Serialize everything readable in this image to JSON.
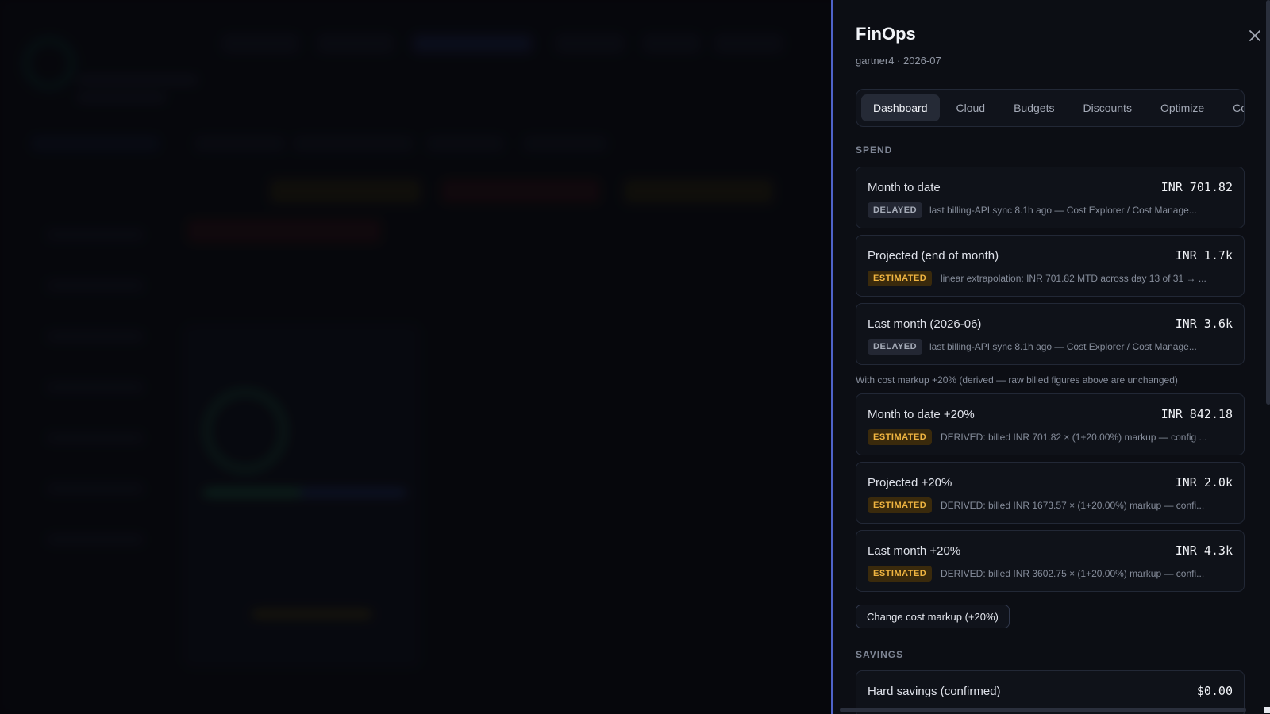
{
  "panel": {
    "title": "FinOps",
    "subtitle": "gartner4 · 2026-07",
    "close_icon": "close-icon",
    "tabs": [
      "Dashboard",
      "Cloud",
      "Budgets",
      "Discounts",
      "Optimize",
      "Con"
    ],
    "active_tab": "Dashboard"
  },
  "spend": {
    "section_label": "SPEND",
    "cards": [
      {
        "label": "Month to date",
        "value": "INR 701.82",
        "badge": "DELAYED",
        "note": "last billing-API sync 8.1h ago — Cost Explorer / Cost Manage..."
      },
      {
        "label": "Projected (end of month)",
        "value": "INR 1.7k",
        "badge": "ESTIMATED",
        "note": "linear extrapolation: INR 701.82 MTD across day 13 of 31 → ..."
      },
      {
        "label": "Last month (2026-06)",
        "value": "INR 3.6k",
        "badge": "DELAYED",
        "note": "last billing-API sync 8.1h ago — Cost Explorer / Cost Manage..."
      }
    ],
    "derived_note": "With cost markup +20% (derived — raw billed figures above are unchanged)",
    "markup_cards": [
      {
        "label": "Month to date +20%",
        "value": "INR 842.18",
        "badge": "ESTIMATED",
        "note": "DERIVED: billed INR 701.82 × (1+20.00%) markup — config ..."
      },
      {
        "label": "Projected +20%",
        "value": "INR 2.0k",
        "badge": "ESTIMATED",
        "note": "DERIVED: billed INR 1673.57 × (1+20.00%) markup — confi..."
      },
      {
        "label": "Last month +20%",
        "value": "INR 4.3k",
        "badge": "ESTIMATED",
        "note": "DERIVED: billed INR 3602.75 × (1+20.00%) markup — confi..."
      }
    ],
    "markup_button": "Change cost markup (+20%)"
  },
  "savings": {
    "section_label": "SAVINGS",
    "cards": [
      {
        "label": "Hard savings (confirmed)",
        "value": "$0.00"
      }
    ]
  },
  "colors": {
    "accent_border": "#4f63c9",
    "estimated_badge": "#f0b541",
    "delayed_badge": "#a6acb8"
  }
}
